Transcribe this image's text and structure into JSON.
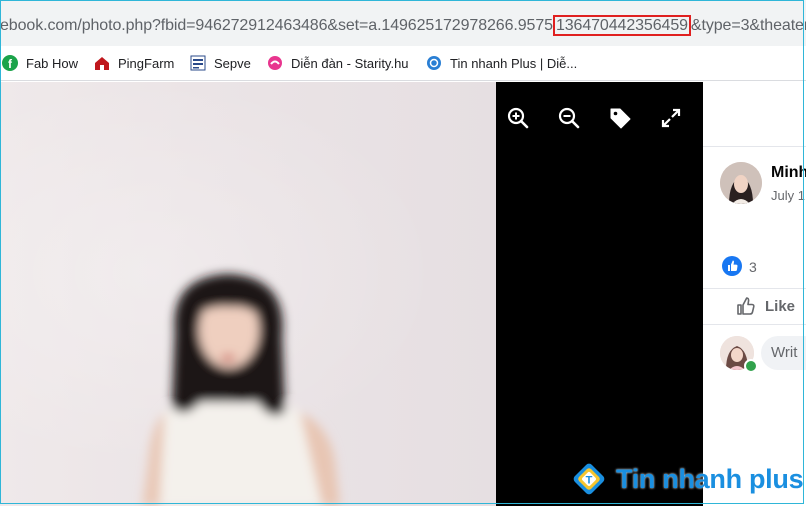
{
  "browser": {
    "url_prefix": "ebook.com/photo.php?fbid=946272912463486&set=a.149625172978266.9575",
    "url_highlight": "136470442356459",
    "url_suffix": "&type=3&theater",
    "highlight_color": "#e02020"
  },
  "bookmarks": [
    {
      "label": "Fab How",
      "icon": "facebook-icon"
    },
    {
      "label": "PingFarm",
      "icon": "pingfarm-icon"
    },
    {
      "label": "Sepve",
      "icon": "sepve-icon"
    },
    {
      "label": "Diễn đàn - Starity.hu",
      "icon": "starity-icon"
    },
    {
      "label": "Tin nhanh Plus | Diễ...",
      "icon": "tinnhanh-icon"
    }
  ],
  "viewer": {
    "buttons": [
      "zoom-in-icon",
      "zoom-out-icon",
      "tag-icon",
      "fullscreen-icon"
    ]
  },
  "post": {
    "author": "Minh",
    "date": "July 1",
    "like_count": "3",
    "like_label": "Like",
    "comment_placeholder": "Writ"
  },
  "watermark": {
    "text": "Tin nhanh plus",
    "color": "#1a8fe0"
  }
}
